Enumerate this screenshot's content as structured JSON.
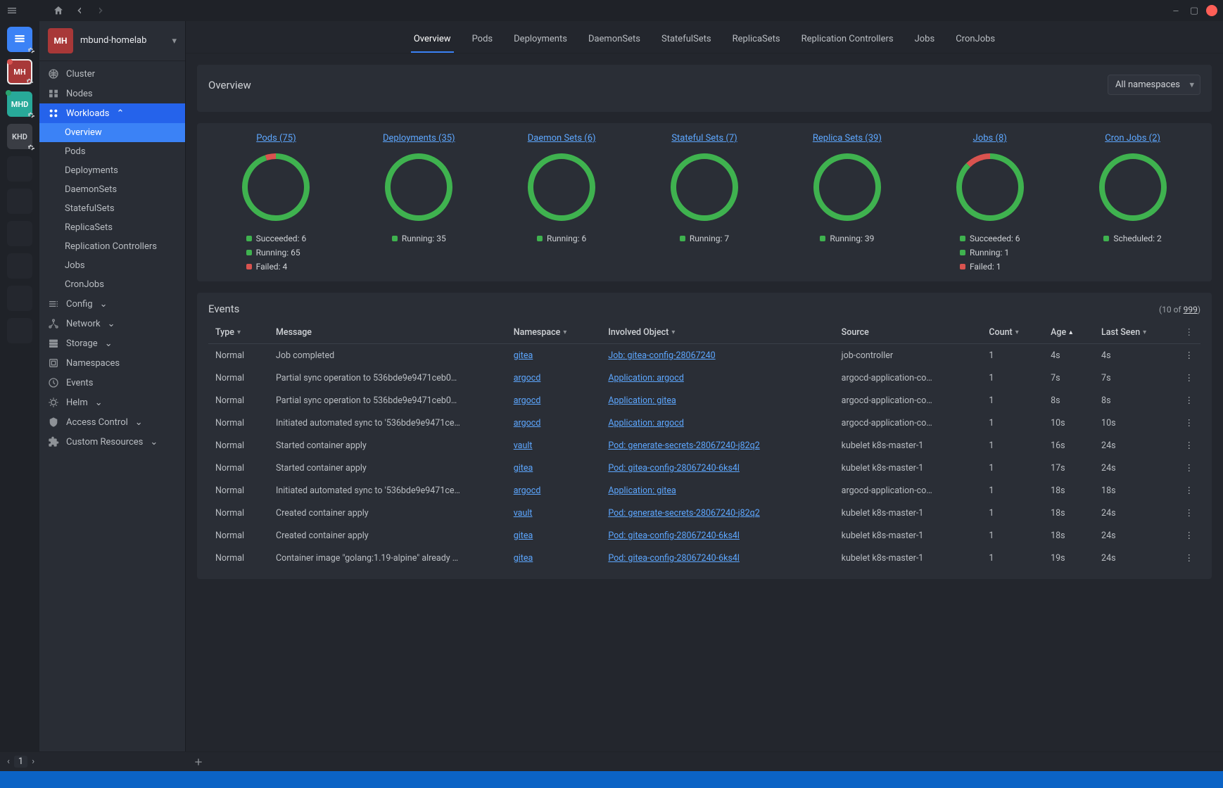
{
  "titlebar": {
    "page_indicator": "1"
  },
  "dock": {
    "tiles": [
      {
        "label": "",
        "variant": "active",
        "icon": "catalog"
      },
      {
        "label": "MH",
        "variant": "red",
        "dot": "#d9534f"
      },
      {
        "label": "MHD",
        "variant": "teal",
        "dot": "#2aa36e"
      },
      {
        "label": "KHD",
        "variant": "gray"
      }
    ]
  },
  "context": {
    "badge": "MH",
    "name": "mbund-homelab"
  },
  "sidebar": {
    "cluster": "Cluster",
    "nodes": "Nodes",
    "workloads": {
      "title": "Workloads",
      "items": [
        "Overview",
        "Pods",
        "Deployments",
        "DaemonSets",
        "StatefulSets",
        "ReplicaSets",
        "Replication Controllers",
        "Jobs",
        "CronJobs"
      ],
      "active_index": 0
    },
    "groups": [
      "Config",
      "Network",
      "Storage",
      "Namespaces",
      "Events",
      "Helm",
      "Access Control",
      "Custom Resources"
    ]
  },
  "tabs": {
    "items": [
      "Overview",
      "Pods",
      "Deployments",
      "DaemonSets",
      "StatefulSets",
      "ReplicaSets",
      "Replication Controllers",
      "Jobs",
      "CronJobs"
    ],
    "active_index": 0
  },
  "overview": {
    "title": "Overview",
    "namespace_selector": "All namespaces",
    "donuts": [
      {
        "title": "Pods (75)",
        "segments": [
          {
            "label": "Succeeded: 6",
            "color": "green",
            "pct": 8
          },
          {
            "label": "Running: 65",
            "color": "green",
            "pct": 86.7
          },
          {
            "label": "Failed: 4",
            "color": "red",
            "pct": 5.3
          }
        ],
        "legend": [
          "Succeeded: 6",
          "Running: 65",
          "Failed: 4"
        ],
        "legend_colors": [
          "green",
          "green",
          "red"
        ],
        "failed_pct": 5.3
      },
      {
        "title": "Deployments (35)",
        "segments": [
          {
            "label": "Running: 35",
            "color": "green",
            "pct": 100
          }
        ],
        "legend": [
          "Running: 35"
        ],
        "legend_colors": [
          "green"
        ],
        "failed_pct": 0
      },
      {
        "title": "Daemon Sets (6)",
        "segments": [
          {
            "label": "Running: 6",
            "color": "green",
            "pct": 100
          }
        ],
        "legend": [
          "Running: 6"
        ],
        "legend_colors": [
          "green"
        ],
        "failed_pct": 0
      },
      {
        "title": "Stateful Sets (7)",
        "segments": [
          {
            "label": "Running: 7",
            "color": "green",
            "pct": 100
          }
        ],
        "legend": [
          "Running: 7"
        ],
        "legend_colors": [
          "green"
        ],
        "failed_pct": 0
      },
      {
        "title": "Replica Sets (39)",
        "segments": [
          {
            "label": "Running: 39",
            "color": "green",
            "pct": 100
          }
        ],
        "legend": [
          "Running: 39"
        ],
        "legend_colors": [
          "green"
        ],
        "failed_pct": 0
      },
      {
        "title": "Jobs (8)",
        "segments": [
          {
            "label": "Succeeded: 6",
            "color": "green",
            "pct": 75
          },
          {
            "label": "Running: 1",
            "color": "green",
            "pct": 12.5
          },
          {
            "label": "Failed: 1",
            "color": "red",
            "pct": 12.5
          }
        ],
        "legend": [
          "Succeeded: 6",
          "Running: 1",
          "Failed: 1"
        ],
        "legend_colors": [
          "green",
          "green",
          "red"
        ],
        "failed_pct": 12.5
      },
      {
        "title": "Cron Jobs (2)",
        "segments": [
          {
            "label": "Scheduled: 2",
            "color": "green",
            "pct": 100
          }
        ],
        "legend": [
          "Scheduled: 2"
        ],
        "legend_colors": [
          "green"
        ],
        "failed_pct": 0
      }
    ]
  },
  "chart_data": [
    {
      "type": "pie",
      "title": "Pods (75)",
      "series": [
        {
          "name": "Succeeded",
          "value": 6
        },
        {
          "name": "Running",
          "value": 65
        },
        {
          "name": "Failed",
          "value": 4
        }
      ]
    },
    {
      "type": "pie",
      "title": "Deployments (35)",
      "series": [
        {
          "name": "Running",
          "value": 35
        }
      ]
    },
    {
      "type": "pie",
      "title": "Daemon Sets (6)",
      "series": [
        {
          "name": "Running",
          "value": 6
        }
      ]
    },
    {
      "type": "pie",
      "title": "Stateful Sets (7)",
      "series": [
        {
          "name": "Running",
          "value": 7
        }
      ]
    },
    {
      "type": "pie",
      "title": "Replica Sets (39)",
      "series": [
        {
          "name": "Running",
          "value": 39
        }
      ]
    },
    {
      "type": "pie",
      "title": "Jobs (8)",
      "series": [
        {
          "name": "Succeeded",
          "value": 6
        },
        {
          "name": "Running",
          "value": 1
        },
        {
          "name": "Failed",
          "value": 1
        }
      ]
    },
    {
      "type": "pie",
      "title": "Cron Jobs (2)",
      "series": [
        {
          "name": "Scheduled",
          "value": 2
        }
      ]
    }
  ],
  "events": {
    "title": "Events",
    "count_text_pre": "(10 of ",
    "count_total": "999",
    "count_text_post": ")",
    "columns": [
      "Type",
      "Message",
      "Namespace",
      "Involved Object",
      "Source",
      "Count",
      "Age",
      "Last Seen",
      ""
    ],
    "sort": {
      "Age": "asc"
    },
    "rows": [
      {
        "type": "Normal",
        "message": "Job completed",
        "namespace": "gitea",
        "object": "Job: gitea-config-28067240",
        "source": "job-controller",
        "count": "1",
        "age": "4s",
        "last": "4s"
      },
      {
        "type": "Normal",
        "message": "Partial sync operation to 536bde9e9471ceb0…",
        "namespace": "argocd",
        "object": "Application: argocd",
        "source": "argocd-application-co…",
        "count": "1",
        "age": "7s",
        "last": "7s"
      },
      {
        "type": "Normal",
        "message": "Partial sync operation to 536bde9e9471ceb0…",
        "namespace": "argocd",
        "object": "Application: gitea",
        "source": "argocd-application-co…",
        "count": "1",
        "age": "8s",
        "last": "8s"
      },
      {
        "type": "Normal",
        "message": "Initiated automated sync to '536bde9e9471ce…",
        "namespace": "argocd",
        "object": "Application: argocd",
        "source": "argocd-application-co…",
        "count": "1",
        "age": "10s",
        "last": "10s"
      },
      {
        "type": "Normal",
        "message": "Started container apply",
        "namespace": "vault",
        "object": "Pod: generate-secrets-28067240-j82q2",
        "source": "kubelet k8s-master-1",
        "count": "1",
        "age": "16s",
        "last": "24s"
      },
      {
        "type": "Normal",
        "message": "Started container apply",
        "namespace": "gitea",
        "object": "Pod: gitea-config-28067240-6ks4l",
        "source": "kubelet k8s-master-1",
        "count": "1",
        "age": "17s",
        "last": "24s"
      },
      {
        "type": "Normal",
        "message": "Initiated automated sync to '536bde9e9471ce…",
        "namespace": "argocd",
        "object": "Application: gitea",
        "source": "argocd-application-co…",
        "count": "1",
        "age": "18s",
        "last": "18s"
      },
      {
        "type": "Normal",
        "message": "Created container apply",
        "namespace": "vault",
        "object": "Pod: generate-secrets-28067240-j82q2",
        "source": "kubelet k8s-master-1",
        "count": "1",
        "age": "18s",
        "last": "24s"
      },
      {
        "type": "Normal",
        "message": "Created container apply",
        "namespace": "gitea",
        "object": "Pod: gitea-config-28067240-6ks4l",
        "source": "kubelet k8s-master-1",
        "count": "1",
        "age": "18s",
        "last": "24s"
      },
      {
        "type": "Normal",
        "message": "Container image \"golang:1.19-alpine\" already …",
        "namespace": "gitea",
        "object": "Pod: gitea-config-28067240-6ks4l",
        "source": "kubelet k8s-master-1",
        "count": "1",
        "age": "19s",
        "last": "24s"
      }
    ]
  }
}
